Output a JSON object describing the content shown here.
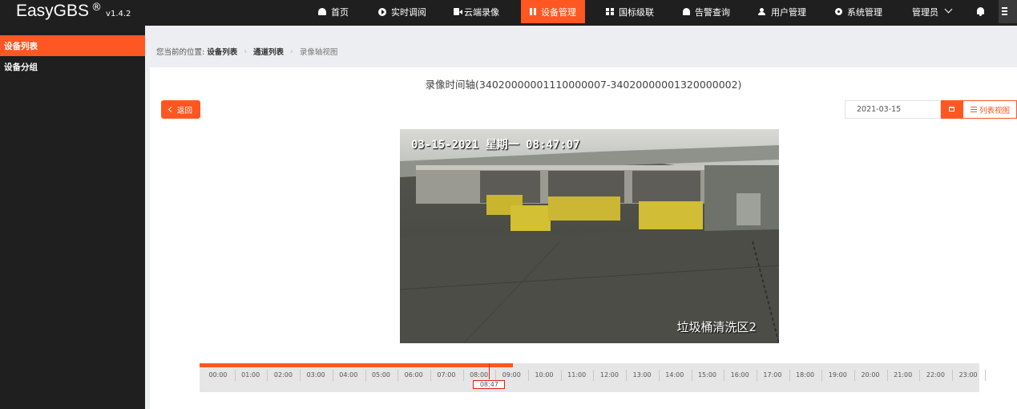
{
  "brand": {
    "name": "EasyGBS",
    "reg": "®",
    "version": "v1.4.2"
  },
  "nav": [
    {
      "label": "首页",
      "icon": "home-icon"
    },
    {
      "label": "实时调阅",
      "icon": "play-circle-icon"
    },
    {
      "label": "云端录像",
      "icon": "video-camera-icon"
    },
    {
      "label": "设备管理",
      "icon": "device-icon",
      "active": true
    },
    {
      "label": "国标级联",
      "icon": "cascade-icon"
    },
    {
      "label": "告警查询",
      "icon": "alarm-icon"
    },
    {
      "label": "用户管理",
      "icon": "user-icon"
    },
    {
      "label": "系统管理",
      "icon": "gear-icon"
    }
  ],
  "user": {
    "label": "管理员"
  },
  "sidebar": {
    "items": [
      {
        "label": "设备列表",
        "active": true
      },
      {
        "label": "设备分组"
      }
    ]
  },
  "breadcrumb": {
    "prefix": "您当前的位置:",
    "items": [
      "设备列表",
      "通道列表",
      "录像轴视图"
    ]
  },
  "page": {
    "title": "录像时间轴(34020000001110000007-34020000001320000002)",
    "back_label": "返回"
  },
  "date_picker": {
    "value": "2021-03-15"
  },
  "list_view_label": "列表视图",
  "video": {
    "osd_time": "03-15-2021 星期一 08:47:07",
    "osd_location": "垃圾桶清洗区2"
  },
  "timeline": {
    "hours": [
      "00:00",
      "01:00",
      "02:00",
      "03:00",
      "04:00",
      "05:00",
      "06:00",
      "07:00",
      "08:00",
      "09:00",
      "10:00",
      "11:00",
      "12:00",
      "13:00",
      "14:00",
      "15:00",
      "16:00",
      "17:00",
      "18:00",
      "19:00",
      "20:00",
      "21:00",
      "22:00",
      "23:00"
    ],
    "recorded_until_hours": 9.5,
    "cursor_hours": 8.78,
    "cursor_label": "08:47"
  },
  "colors": {
    "accent": "#fe5722",
    "nav_bg": "#1f1f1f",
    "cursor": "#e02020"
  }
}
